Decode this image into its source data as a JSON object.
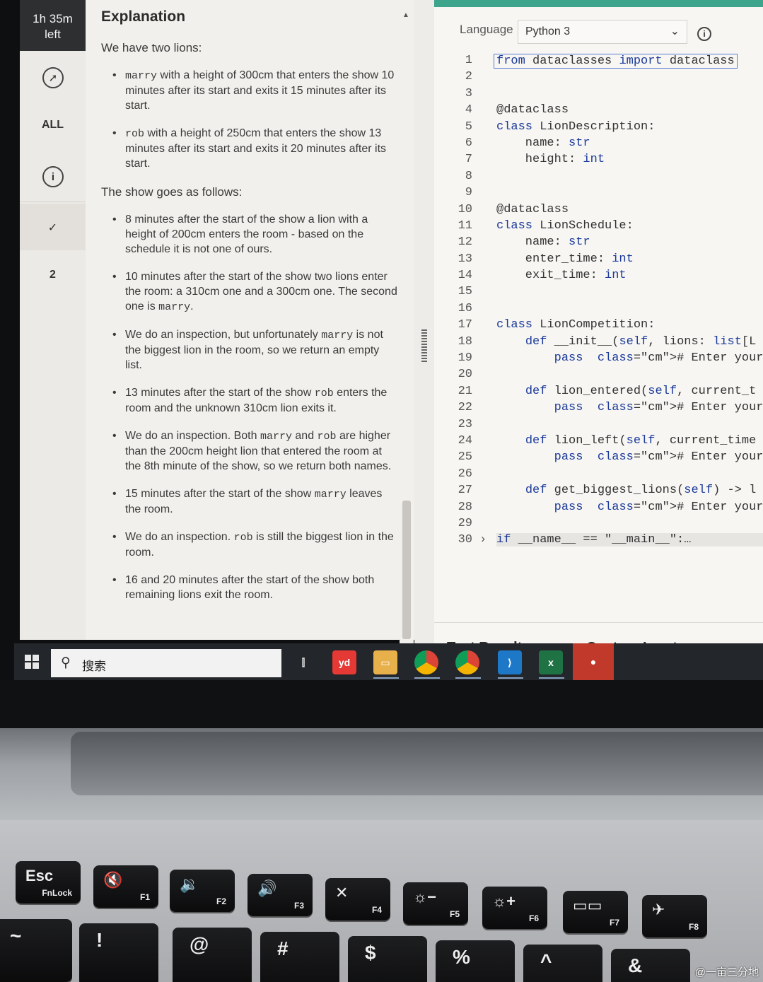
{
  "timer": {
    "line1": "1h 35m",
    "line2": "left"
  },
  "rail": {
    "all_label": "ALL",
    "item_number": "2"
  },
  "explanation": {
    "title": "Explanation",
    "intro": "We have two lions:",
    "lions": [
      {
        "name": "marry",
        "text": " with a height of 300cm that enters the show 10 minutes after its start and exits it 15 minutes after its start."
      },
      {
        "name": "rob",
        "text": " with a height of 250cm that enters the show 13 minutes after its start and exits it 20 minutes after its start."
      }
    ],
    "show_intro": "The show goes as follows:",
    "steps": {
      "s1": "8 minutes after the start of the show a lion with a height of 200cm enters the room - based on the schedule it is not one of ours.",
      "s2a": "10 minutes after the start of the show two lions enter the room: a 310cm one and a 300cm one. The second one is ",
      "s2b": "marry",
      "s2c": ".",
      "s3a": "We do an inspection, but unfortunately ",
      "s3b": "marry",
      "s3c": " is not the biggest lion in the room, so we return an empty list.",
      "s4a": "13 minutes after the start of the show ",
      "s4b": "rob",
      "s4c": " enters the room and the unknown 310cm lion exits it.",
      "s5a": "We do an inspection. Both ",
      "s5b": "marry",
      "s5c": " and ",
      "s5d": "rob",
      "s5e": " are higher than the 200cm height lion that entered the room at the 8th minute of the show, so we return both names.",
      "s6a": "15 minutes after the start of the show ",
      "s6b": "marry",
      "s6c": " leaves the room.",
      "s7a": "We do an inspection. ",
      "s7b": "rob",
      "s7c": " is still the biggest lion in the room.",
      "s8": "16 and 20 minutes after the start of the show both remaining lions exit the room."
    }
  },
  "editor": {
    "language_label": "Language",
    "language_value": "Python 3",
    "lines": [
      {
        "n": "1",
        "t": "from dataclasses import dataclass"
      },
      {
        "n": "2",
        "t": ""
      },
      {
        "n": "3",
        "t": ""
      },
      {
        "n": "4",
        "t": "@dataclass"
      },
      {
        "n": "5",
        "t": "class LionDescription:"
      },
      {
        "n": "6",
        "t": "    name: str"
      },
      {
        "n": "7",
        "t": "    height: int"
      },
      {
        "n": "8",
        "t": ""
      },
      {
        "n": "9",
        "t": ""
      },
      {
        "n": "10",
        "t": "@dataclass"
      },
      {
        "n": "11",
        "t": "class LionSchedule:"
      },
      {
        "n": "12",
        "t": "    name: str"
      },
      {
        "n": "13",
        "t": "    enter_time: int"
      },
      {
        "n": "14",
        "t": "    exit_time: int"
      },
      {
        "n": "15",
        "t": ""
      },
      {
        "n": "16",
        "t": ""
      },
      {
        "n": "17",
        "t": "class LionCompetition:"
      },
      {
        "n": "18",
        "t": "    def __init__(self, lions: list[L"
      },
      {
        "n": "19",
        "t": "        pass  # Enter your code here"
      },
      {
        "n": "20",
        "t": ""
      },
      {
        "n": "21",
        "t": "    def lion_entered(self, current_t"
      },
      {
        "n": "22",
        "t": "        pass  # Enter your code here"
      },
      {
        "n": "23",
        "t": ""
      },
      {
        "n": "24",
        "t": "    def lion_left(self, current_time"
      },
      {
        "n": "25",
        "t": "        pass  # Enter your code here"
      },
      {
        "n": "26",
        "t": ""
      },
      {
        "n": "27",
        "t": "    def get_biggest_lions(self) -> l"
      },
      {
        "n": "28",
        "t": "        pass  # Enter your code here"
      },
      {
        "n": "29",
        "t": ""
      },
      {
        "n": "30",
        "t": "if __name__ == \"__main__\":…"
      }
    ],
    "tabs": {
      "test_results": "Test Results",
      "custom_input": "Custom Input"
    }
  },
  "taskbar": {
    "search_placeholder": "搜索",
    "apps": [
      "file-explorer",
      "youdao",
      "chrome",
      "chrome-profile",
      "vscode",
      "excel",
      "wechat"
    ],
    "youdao_label": "yd"
  },
  "keyboard": {
    "keys": [
      {
        "main": "Esc",
        "sub": "FnLock"
      },
      {
        "main": "🔇",
        "sub": "F1"
      },
      {
        "main": "🔉",
        "sub": "F2"
      },
      {
        "main": "🔊",
        "sub": "F3"
      },
      {
        "main": "✕",
        "sub": "F4"
      },
      {
        "main": "☼−",
        "sub": "F5"
      },
      {
        "main": "☼+",
        "sub": "F6"
      },
      {
        "main": "▭▭",
        "sub": "F7"
      },
      {
        "main": "✈",
        "sub": "F8"
      }
    ],
    "row2": [
      "~",
      "!",
      "@",
      "#",
      "$",
      "%",
      "^",
      "&"
    ]
  },
  "watermark": "@一亩三分地"
}
